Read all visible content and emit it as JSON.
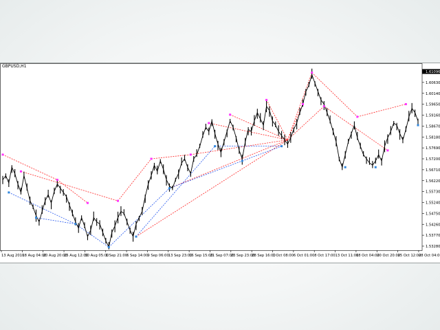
{
  "window": {
    "symbol_label": "GBPUSD,H1"
  },
  "colors": {
    "background": "#ffffff",
    "candle": "#000000",
    "grid": "#c8c8c8",
    "current_price_marker": "#000000",
    "pivot_high_marker": "#ff33ff",
    "pivot_low_marker": "#3388dd",
    "resistance_line": "#ff2222",
    "support_line": "#2255ee"
  },
  "chart_data": {
    "type": "line",
    "symbol": "GBPUSD",
    "timeframe": "H1",
    "grid": false,
    "ylim": [
      1.5265,
      1.6135
    ],
    "y_ticks": [
      "1.61096",
      "1.60630",
      "1.60140",
      "1.59650",
      "1.59160",
      "1.58670",
      "1.58180",
      "1.57690",
      "1.57200",
      "1.56710",
      "1.56220",
      "1.55730",
      "1.55240",
      "1.54750",
      "1.54260",
      "1.53770",
      "1.53280"
    ],
    "current_price": "1.61096",
    "x_ticks": [
      "13 Aug 2010",
      "18 Aug 04:00",
      "20 Aug 20:00",
      "25 Aug 12:00",
      "30 Aug 05:00",
      "1 Sep 21:00",
      "6 Sep 14:00",
      "9 Sep 06:00",
      "13 Sep 23:00",
      "16 Sep 15:00",
      "21 Sep 07:00",
      "23 Sep 23:00",
      "28 Sep 16:00",
      "1 Oct 08:00",
      "6 Oct 01:00",
      "8 Oct 17:00",
      "13 Oct 11:00",
      "18 Oct 04:00",
      "20 Oct 20:00",
      "25 Oct 12:00",
      "28 Oct 04:00"
    ],
    "series": [
      {
        "values": [
          1.56,
          1.562,
          1.5585,
          1.566,
          1.563,
          1.558,
          1.554,
          1.562,
          1.556,
          1.55,
          1.547,
          1.543,
          1.54,
          1.545,
          1.55,
          1.553,
          1.549,
          1.5545,
          1.558,
          1.556,
          1.554,
          1.552,
          1.548,
          1.544,
          1.54,
          1.537,
          1.542,
          1.538,
          1.533,
          1.536,
          1.542,
          1.54,
          1.539,
          1.535,
          1.531,
          1.528,
          1.535,
          1.538,
          1.542,
          1.545,
          1.544,
          1.54,
          1.536,
          1.533,
          1.539,
          1.542,
          1.545,
          1.552,
          1.558,
          1.562,
          1.567,
          1.564,
          1.569,
          1.565,
          1.56,
          1.557,
          1.556,
          1.56,
          1.563,
          1.568,
          1.57,
          1.566,
          1.563,
          1.57,
          1.572,
          1.576,
          1.581,
          1.585,
          1.583,
          1.588,
          1.582,
          1.577,
          1.573,
          1.578,
          1.583,
          1.588,
          1.585,
          1.58,
          1.574,
          1.57,
          1.578,
          1.584,
          1.583,
          1.588,
          1.592,
          1.589,
          1.586,
          1.595,
          1.593,
          1.588,
          1.586,
          1.583,
          1.581,
          1.579,
          1.577,
          1.58,
          1.584,
          1.587,
          1.592,
          1.596,
          1.602,
          1.605,
          1.61,
          1.606,
          1.602,
          1.598,
          1.596,
          1.592,
          1.588,
          1.583,
          1.578,
          1.57,
          1.566,
          1.572,
          1.578,
          1.582,
          1.586,
          1.58,
          1.576,
          1.572,
          1.57,
          1.568,
          1.567,
          1.569,
          1.572,
          1.569,
          1.576,
          1.58,
          1.583,
          1.587,
          1.586,
          1.582,
          1.579,
          1.584,
          1.59,
          1.594,
          1.592,
          1.588
        ]
      }
    ],
    "pivot_highs": [
      [
        0,
        1.572
      ],
      [
        6,
        1.564
      ],
      [
        18,
        1.56
      ],
      [
        28,
        1.549
      ],
      [
        38,
        1.55
      ],
      [
        49,
        1.57
      ],
      [
        62,
        1.572
      ],
      [
        68,
        1.587
      ],
      [
        75,
        1.591
      ],
      [
        87,
        1.598
      ],
      [
        99,
        1.596
      ],
      [
        102,
        1.611
      ],
      [
        106,
        1.595
      ],
      [
        117,
        1.59
      ],
      [
        127,
        1.574
      ],
      [
        133,
        1.596
      ]
    ],
    "pivot_lows": [
      [
        2,
        1.554
      ],
      [
        11,
        1.542
      ],
      [
        24,
        1.539
      ],
      [
        35,
        1.528
      ],
      [
        44,
        1.533
      ],
      [
        55,
        1.556
      ],
      [
        70,
        1.576
      ],
      [
        79,
        1.569
      ],
      [
        92,
        1.576
      ],
      [
        113,
        1.566
      ],
      [
        123,
        1.566
      ],
      [
        137,
        1.586
      ]
    ],
    "resistance_lines": [
      [
        [
          6,
          1.564
        ],
        [
          38,
          1.55
        ]
      ],
      [
        [
          18,
          1.56
        ],
        [
          28,
          1.549
        ]
      ],
      [
        [
          0,
          1.572
        ],
        [
          18,
          1.56
        ]
      ],
      [
        [
          38,
          1.55
        ],
        [
          49,
          1.57
        ]
      ],
      [
        [
          49,
          1.57
        ],
        [
          62,
          1.572
        ]
      ],
      [
        [
          62,
          1.572
        ],
        [
          94,
          1.579
        ]
      ],
      [
        [
          68,
          1.587
        ],
        [
          94,
          1.579
        ]
      ],
      [
        [
          75,
          1.591
        ],
        [
          94,
          1.579
        ]
      ],
      [
        [
          87,
          1.598
        ],
        [
          94,
          1.579
        ]
      ],
      [
        [
          94,
          1.579
        ],
        [
          102,
          1.611
        ]
      ],
      [
        [
          94,
          1.579
        ],
        [
          99,
          1.596
        ]
      ],
      [
        [
          94,
          1.579
        ],
        [
          106,
          1.595
        ]
      ],
      [
        [
          102,
          1.611
        ],
        [
          117,
          1.59
        ]
      ],
      [
        [
          106,
          1.595
        ],
        [
          127,
          1.574
        ]
      ],
      [
        [
          117,
          1.59
        ],
        [
          133,
          1.596
        ]
      ],
      [
        [
          44,
          1.533
        ],
        [
          94,
          1.579
        ]
      ],
      [
        [
          55,
          1.556
        ],
        [
          94,
          1.579
        ]
      ]
    ],
    "support_lines": [
      [
        [
          2,
          1.554
        ],
        [
          24,
          1.539
        ]
      ],
      [
        [
          11,
          1.542
        ],
        [
          24,
          1.539
        ]
      ],
      [
        [
          24,
          1.539
        ],
        [
          35,
          1.528
        ]
      ],
      [
        [
          35,
          1.528
        ],
        [
          55,
          1.556
        ]
      ],
      [
        [
          44,
          1.533
        ],
        [
          70,
          1.576
        ]
      ],
      [
        [
          55,
          1.556
        ],
        [
          79,
          1.569
        ]
      ],
      [
        [
          70,
          1.576
        ],
        [
          92,
          1.576
        ]
      ],
      [
        [
          79,
          1.569
        ],
        [
          92,
          1.576
        ]
      ]
    ]
  }
}
